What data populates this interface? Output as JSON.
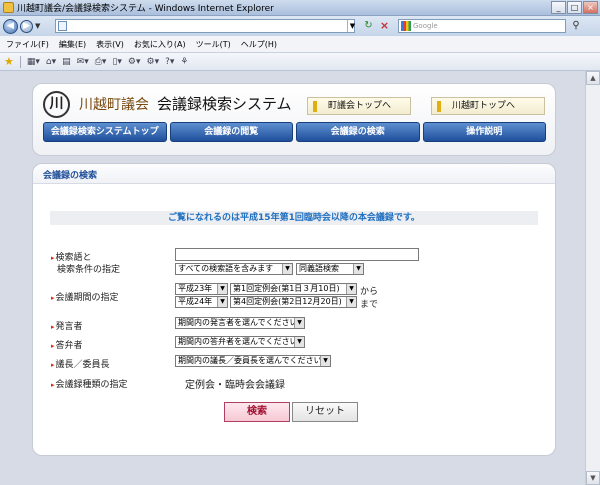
{
  "window": {
    "title": "川越町議会/会議録検索システム - Windows Internet Explorer"
  },
  "search": {
    "placeholder": "Google"
  },
  "menu": [
    "ファイル(F)",
    "編集(E)",
    "表示(V)",
    "お気に入り(A)",
    "ツール(T)",
    "ヘルプ(H)"
  ],
  "header": {
    "logo_mark": "川",
    "town": "川越町議会",
    "system": "会議録検索システム",
    "link_top_council": "町議会トップへ",
    "link_top_town": "川越町トップへ"
  },
  "nav": [
    "会議録検索システムトップ",
    "会議録の閲覧",
    "会議録の検索",
    "操作説明"
  ],
  "panel": {
    "title": "会議録の検索",
    "notice": "ご覧になれるのは平成15年第1回臨時会以降の本会議録です。"
  },
  "form": {
    "keyword_label_1": "検索語と",
    "keyword_label_2": "検索条件の指定",
    "keyword_mode": "すべての検索語を含みます",
    "keyword_type": "同義語検索",
    "period_label": "会議期間の指定",
    "period_from_year": "平成23年",
    "period_from_session": "第1回定例会(第1日３月10日)",
    "period_from_suffix": "から",
    "period_to_year": "平成24年",
    "period_to_session": "第4回定例会(第2日12月20日)",
    "period_to_suffix": "まで",
    "speaker_label": "発言者",
    "speaker_value": "期間内の発言者を選んでください",
    "answerer_label": "答弁者",
    "answerer_value": "期間内の答弁者を選んでください",
    "chair_label": "議長／委員長",
    "chair_value": "期間内の議長／委員長を選んでください",
    "type_label": "会議録種類の指定",
    "type_value": "定例会・臨時会会議録",
    "search_button": "検索",
    "reset_button": "リセット"
  }
}
